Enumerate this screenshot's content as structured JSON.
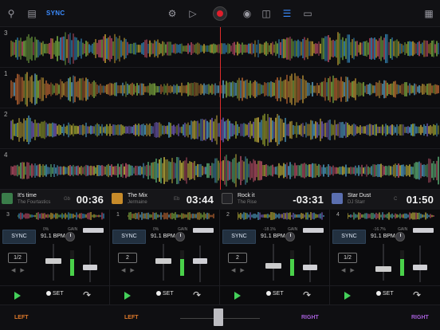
{
  "toolbar": {
    "sync_label": "SYNC",
    "icons": [
      "search-icon",
      "library-icon",
      "gear-icon",
      "video-icon",
      "record-icon",
      "fx-icon",
      "split-icon",
      "waveform-view-icon",
      "display-icon",
      "sampler-icon"
    ]
  },
  "waveforms": {
    "lanes": [
      {
        "number": "3",
        "color": "#4aa8e0"
      },
      {
        "number": "1",
        "color": "#d9a93b"
      },
      {
        "number": "2",
        "color": "#c8d83a"
      },
      {
        "number": "4",
        "color": "#5ec0f0"
      }
    ]
  },
  "decks": [
    {
      "title": "It's time",
      "artist": "The Fourtastics",
      "key": "Gb",
      "time": "00:36",
      "mini_number": "3",
      "art_color": "#3a7d4a",
      "sync": "SYNC",
      "pct": "0%",
      "bpm": "91.1 BPM",
      "gain": "GAIN",
      "loop": "1/2",
      "set": "SET"
    },
    {
      "title": "The Mix",
      "artist": "Jermaine",
      "key": "Eb",
      "time": "03:44",
      "mini_number": "1",
      "art_color": "#c78b2a",
      "sync": "SYNC",
      "pct": "0%",
      "bpm": "91.1 BPM",
      "gain": "GAIN",
      "loop": "2",
      "set": "SET"
    },
    {
      "title": "Rock it",
      "artist": "The Rise",
      "key": "",
      "time": "-03:31",
      "mini_number": "2",
      "art_color": "#222226",
      "sync": "SYNC",
      "pct": "-18.1%",
      "bpm": "91.1 BPM",
      "gain": "GAIN",
      "loop": "2",
      "set": "SET"
    },
    {
      "title": "Star Dust",
      "artist": "DJ Starr",
      "key": "C",
      "time": "01:50",
      "mini_number": "4",
      "art_color": "#5b6fb0",
      "sync": "SYNC",
      "pct": "-16.7%",
      "bpm": "91.1 BPM",
      "gain": "GAIN",
      "loop": "1/2",
      "set": "SET"
    }
  ],
  "crossfader": {
    "left_a": "LEFT",
    "left_b": "LEFT",
    "right_a": "RIGHT",
    "right_b": "RIGHT"
  },
  "colors": {
    "accent": "#3b8cff",
    "record": "#e01e2b",
    "play": "#44d05a",
    "left": "#e07a2b",
    "right": "#a55ed8"
  }
}
